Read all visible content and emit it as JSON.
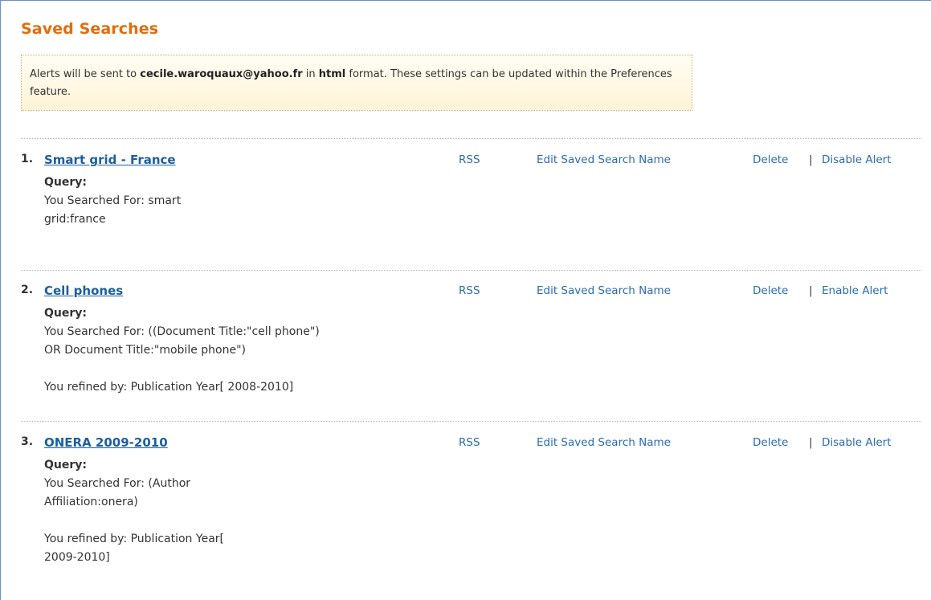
{
  "header": {
    "title": "Saved Searches"
  },
  "notice": {
    "prefix": "Alerts will be sent to ",
    "email": "cecile.waroquaux@yahoo.fr",
    "middle": " in ",
    "format": "html",
    "suffix": " format. These settings can be updated within the Preferences feature."
  },
  "actions": {
    "rss": "RSS",
    "edit": "Edit Saved Search Name",
    "delete": "Delete",
    "separator": "|"
  },
  "searches": [
    {
      "number": "1.",
      "name": "Smart grid - France",
      "query_label": "Query:",
      "searched_line1": "You Searched For:  smart",
      "searched_line2": "grid:france",
      "refined_line1": "",
      "refined_line2": "",
      "alert_action": "Disable Alert"
    },
    {
      "number": "2.",
      "name": "Cell phones",
      "query_label": "Query:",
      "searched_line1": "You Searched For:  ((Document Title:\"cell phone\")",
      "searched_line2": "OR Document Title:\"mobile phone\")",
      "refined_line1": "You refined by: Publication Year[ 2008-2010]",
      "refined_line2": "",
      "alert_action": "Enable Alert"
    },
    {
      "number": "3.",
      "name": "ONERA 2009-2010",
      "query_label": "Query:",
      "searched_line1": "You Searched For:  (Author",
      "searched_line2": "Affiliation:onera)",
      "refined_line1": "You refined by: Publication Year[",
      "refined_line2": "2009-2010]",
      "alert_action": "Disable Alert"
    }
  ]
}
